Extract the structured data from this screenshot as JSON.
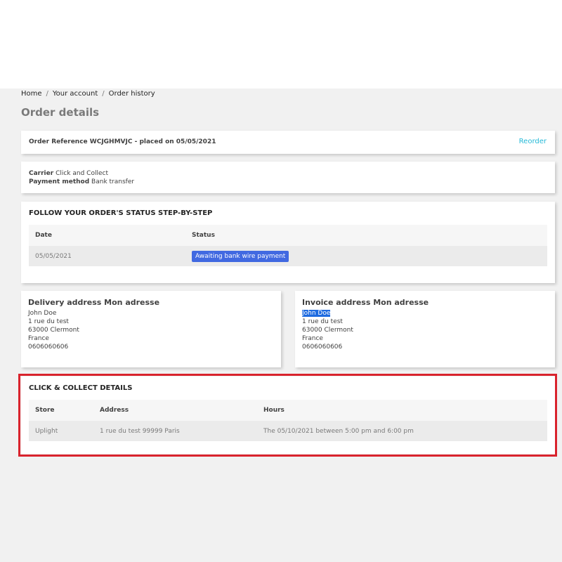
{
  "breadcrumb": {
    "items": [
      "Home",
      "Your account",
      "Order history"
    ],
    "separator": "/"
  },
  "page_title": "Order details",
  "order": {
    "reference_text": "Order Reference WCJGHMVJC - placed on 05/05/2021",
    "reorder_label": "Reorder"
  },
  "shipping": {
    "carrier_label": "Carrier",
    "carrier_value": "Click and Collect",
    "payment_label": "Payment method",
    "payment_value": "Bank transfer"
  },
  "status": {
    "title": "FOLLOW YOUR ORDER'S STATUS STEP-BY-STEP",
    "headers": [
      "Date",
      "Status"
    ],
    "rows": [
      {
        "date": "05/05/2021",
        "status": "Awaiting bank wire payment",
        "status_color": "#4169e1"
      }
    ]
  },
  "delivery_address": {
    "title": "Delivery address Mon adresse",
    "lines": [
      "John Doe",
      "1 rue du test",
      "63000 Clermont",
      "France",
      "0606060606"
    ]
  },
  "invoice_address": {
    "title": "Invoice address Mon adresse",
    "lines": [
      "John Doe",
      "1 rue du test",
      "63000 Clermont",
      "France",
      "0606060606"
    ]
  },
  "click_collect": {
    "title": "CLICK & COLLECT DETAILS",
    "headers": [
      "Store",
      "Address",
      "Hours"
    ],
    "rows": [
      {
        "store": "Uplight",
        "address": "1 rue du test 99999 Paris",
        "hours": "The 05/10/2021 between 5:00 pm and 6:00 pm"
      }
    ]
  },
  "colors": {
    "accent_link": "#24b9d7",
    "highlight_outline": "#d9232d",
    "selection": "#1e6be0"
  }
}
